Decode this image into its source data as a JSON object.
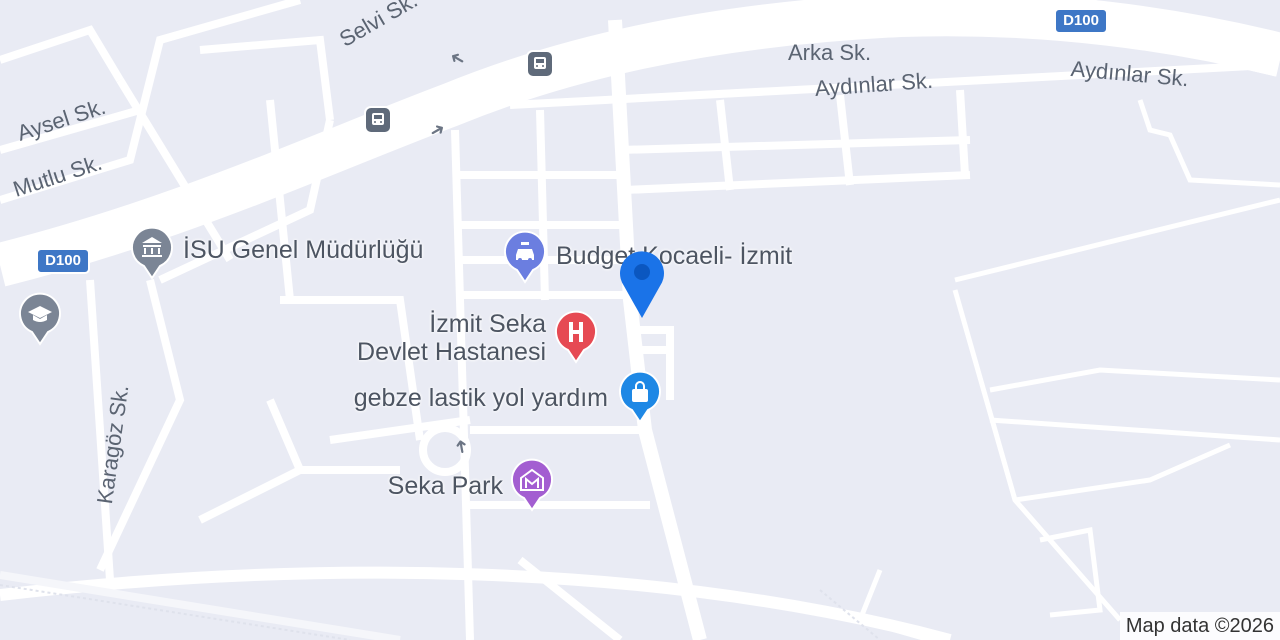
{
  "map": {
    "background": "#e9ebf4",
    "road_color": "#ffffff",
    "route_shields": [
      {
        "label": "D100",
        "color": "#3e77c6"
      },
      {
        "label": "D100",
        "color": "#3e77c6"
      }
    ],
    "streets": [
      {
        "name": "Selvi Sk."
      },
      {
        "name": "Arka Sk."
      },
      {
        "name": "Aydınlar Sk."
      },
      {
        "name": "Aydınlar Sk."
      },
      {
        "name": "Aysel Sk."
      },
      {
        "name": "Mutlu Sk."
      },
      {
        "name": "Karagöz Sk."
      }
    ],
    "pois": [
      {
        "name": "İSU Genel Müdürlüğü",
        "icon": "government-building-icon",
        "color": "#7b8595"
      },
      {
        "name": "Budget Kocaeli- İzmit",
        "icon": "car-rental-icon",
        "color": "#6b7ee0"
      },
      {
        "name": "İzmit Seka",
        "name_line2": "Devlet Hastanesi",
        "icon": "hospital-icon",
        "color": "#e64a53"
      },
      {
        "name": "gebze lastik yol yardım",
        "icon": "shopping-bag-icon",
        "color": "#1e88e5"
      },
      {
        "name": "Seka Park",
        "icon": "shopping-mall-icon",
        "color": "#a35ed1"
      },
      {
        "name": "",
        "icon": "school-icon",
        "color": "#7b8595"
      }
    ],
    "transit": [
      {
        "icon": "bus-stop-icon"
      },
      {
        "icon": "bus-stop-icon"
      }
    ],
    "location_marker": {
      "icon": "location-pin-icon",
      "color": "#1a73e8"
    },
    "attribution": "Map data ©2026"
  }
}
